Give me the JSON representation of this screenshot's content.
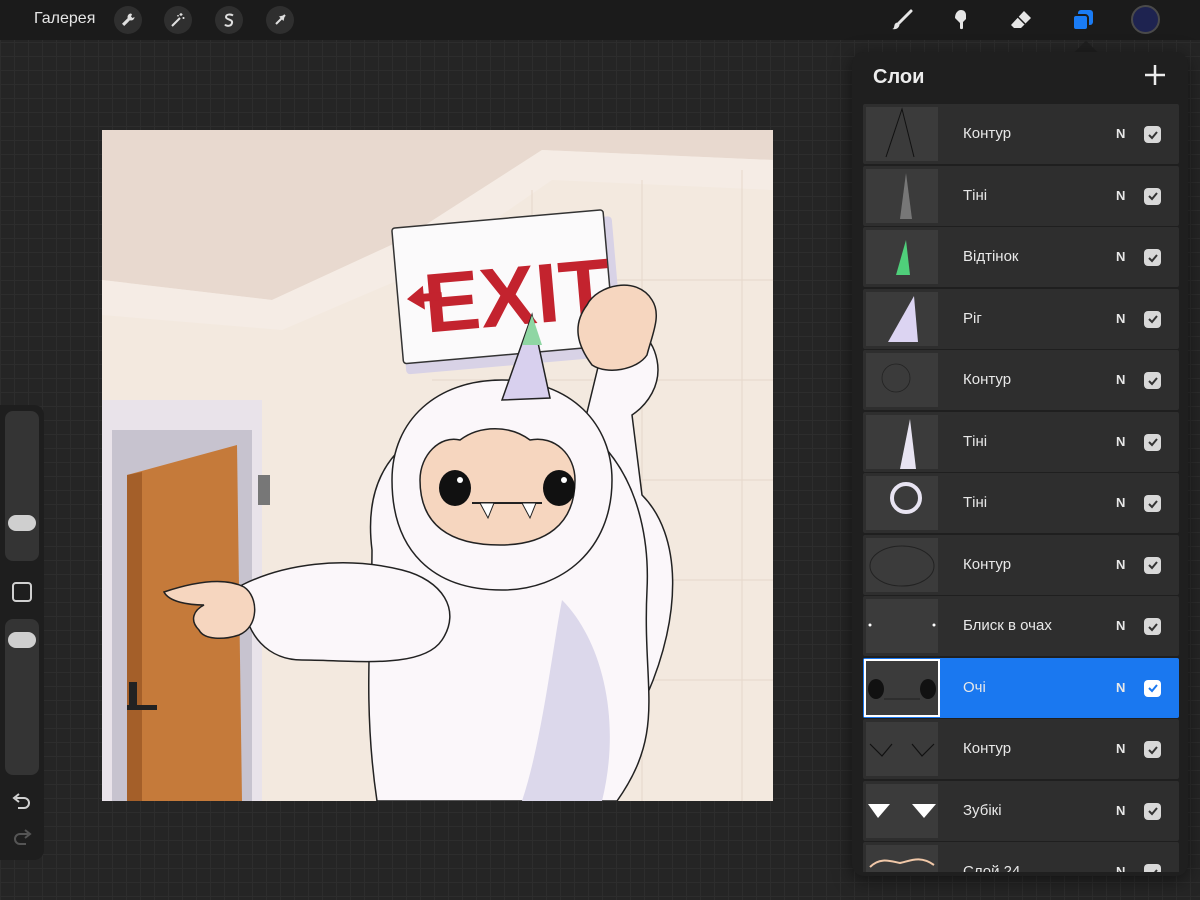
{
  "topbar": {
    "gallery_label": "Галерея",
    "left_tools": [
      "wrench-icon",
      "magic-wand-icon",
      "selection-s-icon",
      "transform-arrow-icon"
    ],
    "right_tools": [
      "brush-icon",
      "smudge-icon",
      "eraser-icon",
      "layers-icon"
    ],
    "active_color": "#1e2350"
  },
  "sidebar": {
    "brush_size_level": 0.3,
    "opacity_level": 0.95,
    "icons": [
      "modify-square-icon",
      "undo-icon",
      "redo-icon"
    ]
  },
  "canvas": {
    "sign_text": "EXIT"
  },
  "layers": {
    "title": "Слои",
    "add_icon": "plus-icon",
    "items": [
      {
        "name": "Контур",
        "mode": "N",
        "visible": true,
        "selected": false
      },
      {
        "name": "Тіні",
        "mode": "N",
        "visible": true,
        "selected": false
      },
      {
        "name": "Відтінок",
        "mode": "N",
        "visible": true,
        "selected": false
      },
      {
        "name": "Ріг",
        "mode": "N",
        "visible": true,
        "selected": false
      },
      {
        "name": "Контур",
        "mode": "N",
        "visible": true,
        "selected": false
      },
      {
        "name": "Тіні",
        "mode": "N",
        "visible": true,
        "selected": false
      },
      {
        "name": "Тіні",
        "mode": "N",
        "visible": true,
        "selected": false
      },
      {
        "name": "Контур",
        "mode": "N",
        "visible": true,
        "selected": false
      },
      {
        "name": "Блиск в очах",
        "mode": "N",
        "visible": true,
        "selected": false
      },
      {
        "name": "Очі",
        "mode": "N",
        "visible": true,
        "selected": true
      },
      {
        "name": "Контур",
        "mode": "N",
        "visible": true,
        "selected": false
      },
      {
        "name": "Зубікі",
        "mode": "N",
        "visible": true,
        "selected": false
      },
      {
        "name": "Слой 24",
        "mode": "N",
        "visible": true,
        "selected": false
      }
    ]
  },
  "colors": {
    "accent": "#1a78f0",
    "active_tool": "#1a7cf5"
  }
}
